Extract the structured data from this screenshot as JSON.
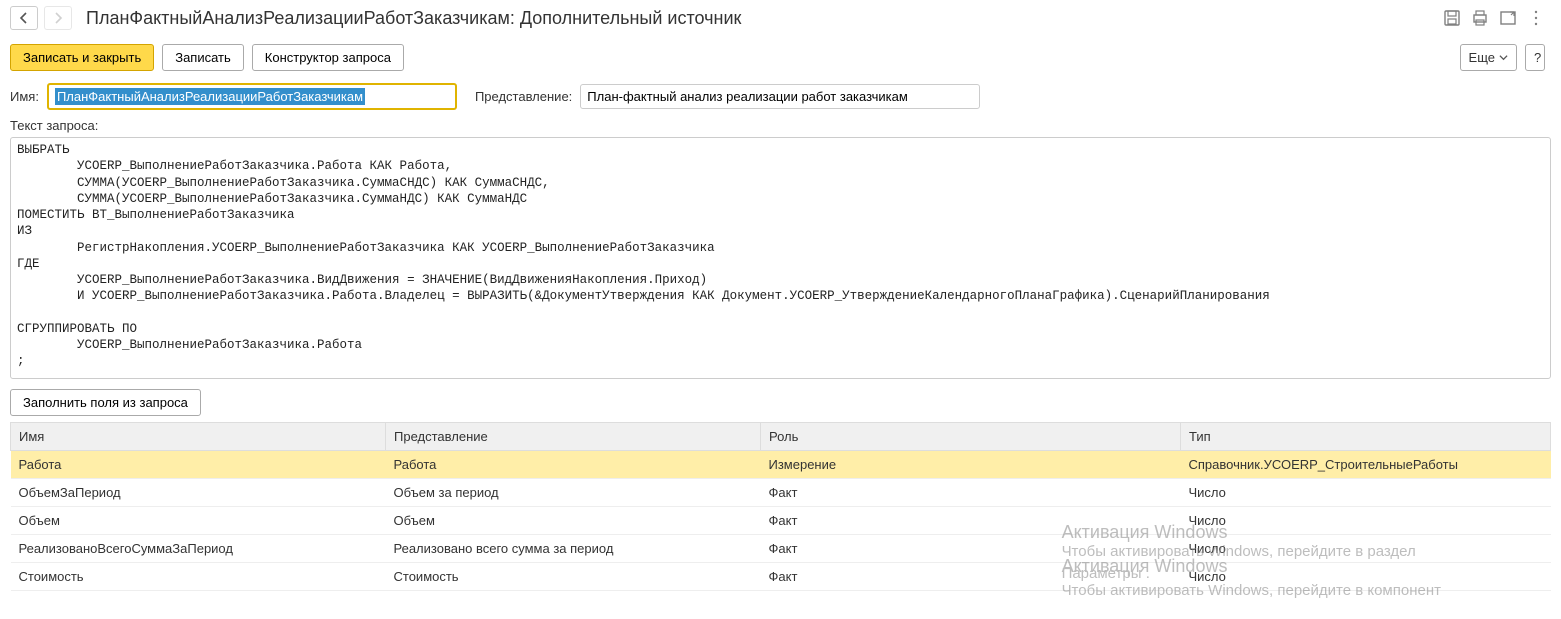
{
  "header": {
    "title": "ПланФактныйАнализРеализацииРаботЗаказчикам: Дополнительный источник"
  },
  "toolbar": {
    "write_close": "Записать и закрыть",
    "write": "Записать",
    "query_builder": "Конструктор запроса",
    "more": "Еще",
    "help": "?"
  },
  "fields": {
    "name_label": "Имя:",
    "name_value": "ПланФактныйАнализРеализацииРаботЗаказчикам",
    "pres_label": "Представление:",
    "pres_value": "План-фактный анализ реализации работ заказчикам"
  },
  "query": {
    "label": "Текст запроса:",
    "text": "ВЫБРАТЬ\n        УСОERP_ВыполнениеРаботЗаказчика.Работа КАК Работа,\n        СУММА(УСОERP_ВыполнениеРаботЗаказчика.СуммаСНДС) КАК СуммаСНДС,\n        СУММА(УСОERP_ВыполнениеРаботЗаказчика.СуммаНДС) КАК СуммаНДС\nПОМЕСТИТЬ ВТ_ВыполнениеРаботЗаказчика\nИЗ\n        РегистрНакопления.УСОERP_ВыполнениеРаботЗаказчика КАК УСОERP_ВыполнениеРаботЗаказчика\nГДЕ\n        УСОERP_ВыполнениеРаботЗаказчика.ВидДвижения = ЗНАЧЕНИЕ(ВидДвиженияНакопления.Приход)\n        И УСОERP_ВыполнениеРаботЗаказчика.Работа.Владелец = ВЫРАЗИТЬ(&ДокументУтверждения КАК Документ.УСОERP_УтверждениеКалендарногоПланаГрафика).СценарийПланирования\n\nСГРУППИРОВАТЬ ПО\n        УСОERP_ВыполнениеРаботЗаказчика.Работа\n;\n\n////////////////////////////////////////////////////////////////////////////////"
  },
  "fill_button": "Заполнить поля из запроса",
  "table": {
    "headers": {
      "name": "Имя",
      "pres": "Представление",
      "role": "Роль",
      "type": "Тип"
    },
    "rows": [
      {
        "name": "Работа",
        "pres": "Работа",
        "role": "Измерение",
        "type": "Справочник.УСОERP_СтроительныеРаботы",
        "selected": true
      },
      {
        "name": "ОбъемЗаПериод",
        "pres": "Объем за период",
        "role": "Факт",
        "type": "Число"
      },
      {
        "name": "Объем",
        "pres": "Объем",
        "role": "Факт",
        "type": "Число"
      },
      {
        "name": "РеализованоВсегоСуммаЗаПериод",
        "pres": "Реализовано всего сумма за период",
        "role": "Факт",
        "type": "Число"
      },
      {
        "name": "Стоимость",
        "pres": "Стоимость",
        "role": "Факт",
        "type": "Число"
      }
    ]
  },
  "watermark": {
    "title1": "Активация Windows",
    "sub1": "Чтобы активировать Windows, перейдите в раздел",
    "title2": "Активация Windows",
    "sub2": "Параметры .",
    "sub3": "Чтобы активировать Windows, перейдите в компонент"
  }
}
